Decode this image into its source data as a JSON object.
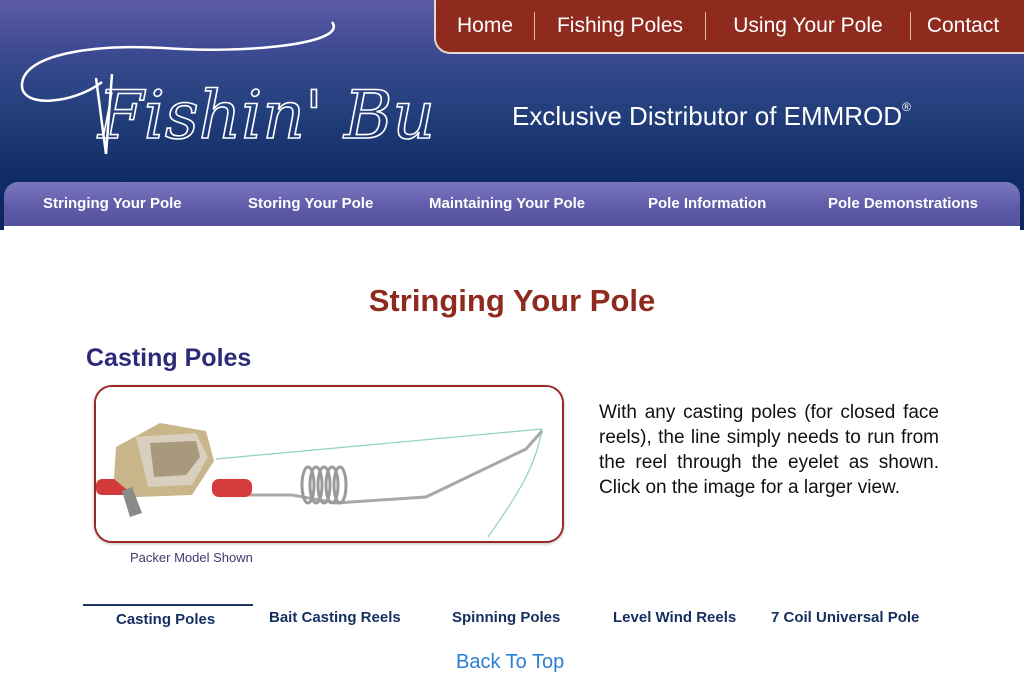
{
  "brand": {
    "logo_text": "Fishin' Buddy"
  },
  "tagline": {
    "text": "Exclusive Distributor of EMMROD",
    "mark": "®"
  },
  "top_nav": [
    "Home",
    "Fishing Poles",
    "Using Your Pole",
    "Contact"
  ],
  "sub_nav": [
    "Stringing Your Pole",
    "Storing Your Pole",
    "Maintaining Your Pole",
    "Pole Information",
    "Pole Demonstrations"
  ],
  "page": {
    "title": "Stringing Your Pole",
    "section_title": "Casting Poles",
    "photo_caption": "Packer Model Shown",
    "body": "With any casting poles (for closed face reels), the line simply needs to run from the reel through the eyelet as shown. Click on the image for a larger view."
  },
  "tabs": [
    "Casting Poles",
    "Bait Casting Reels",
    "Spinning Poles",
    "Level Wind Reels",
    "7 Coil Universal Pole"
  ],
  "active_tab": "Casting Poles",
  "back_to_top": "Back To Top",
  "colors": {
    "accent_red": "#8f2a1e",
    "nav_purple": "#5e5aa8",
    "header_navy": "#102a63",
    "heading_indigo": "#2d2a78",
    "link_blue": "#2b7fd6"
  }
}
